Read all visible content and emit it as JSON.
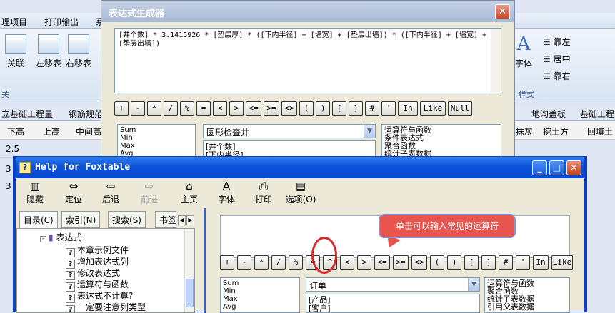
{
  "app": {
    "menu": [
      "理项目",
      "打印输出",
      "系"
    ],
    "ribbon_buttons": [
      "关联",
      "左移表",
      "右移表"
    ],
    "ribbon_right": [
      "字体",
      "靠左",
      "居中",
      "靠右"
    ],
    "ribbon_groups": [
      "关",
      "样式"
    ],
    "tabs_left": [
      "立基础工程量",
      "钢筋规范"
    ],
    "tabs_right": [
      "地沟盖板",
      "基础工程"
    ],
    "grid_headers": [
      "下高",
      "上高",
      "中间高"
    ],
    "grid_headers_right": [
      "抹灰",
      "挖土方",
      "回填土"
    ],
    "grid_values": [
      "2.5",
      "3",
      "3"
    ]
  },
  "expr_dialog": {
    "title": "表达式生成器",
    "close_glyph": "✕",
    "expression": "[井个数] * 3.1415926 * [垫层厚] * ([下内半径] + [墙宽] + [垫层出墙]) * ([下内半径] + [墙宽] + [垫层出墙])",
    "operators": [
      "+",
      "-",
      "*",
      "/",
      "%",
      "=",
      "<",
      ">",
      "<=",
      ">=",
      "<>",
      "(",
      ")",
      "[",
      "]",
      "#",
      "'",
      "In",
      "Like",
      "Null"
    ],
    "functions": [
      "Sum",
      "Min",
      "Max",
      "Avg"
    ],
    "table_combo": "圆形检查井",
    "fields": [
      "[井个数]",
      "[下内半径]"
    ],
    "categories": [
      "运算符与函数",
      "条件表达式",
      "聚合函数",
      "统计子表数据"
    ]
  },
  "help_window": {
    "title": "Help for Foxtable",
    "icon_glyph": "?",
    "minimize_glyph": "_",
    "maximize_glyph": "□",
    "close_glyph": "✕",
    "toolbar": [
      {
        "label": "隐藏",
        "icon": "hide-icon",
        "glyph": "▥",
        "enabled": true
      },
      {
        "label": "定位",
        "icon": "locate-icon",
        "glyph": "⇔",
        "enabled": true
      },
      {
        "label": "后退",
        "icon": "back-icon",
        "glyph": "⇦",
        "enabled": true
      },
      {
        "label": "前进",
        "icon": "forward-icon",
        "glyph": "⇨",
        "enabled": false
      },
      {
        "label": "主页",
        "icon": "home-icon",
        "glyph": "⌂",
        "enabled": true
      },
      {
        "label": "字体",
        "icon": "font-icon",
        "glyph": "A",
        "enabled": true
      },
      {
        "label": "打印",
        "icon": "print-icon",
        "glyph": "⎙",
        "enabled": true
      },
      {
        "label": "选项(O)",
        "icon": "options-icon",
        "glyph": "▤",
        "enabled": true
      }
    ],
    "nav_tabs": [
      "目录(C)",
      "索引(N)",
      "搜索(S)",
      "书签"
    ],
    "tree_parent": "表达式",
    "tree_items": [
      "本章示例文件",
      "增加表达式列",
      "修改表达式",
      "运算符与函数",
      "表达式不计算?",
      "一定要注意列类型"
    ],
    "tip_text": "单击可以输入常见的运算符",
    "inner_operators": [
      "+",
      "-",
      "*",
      "/",
      "%",
      "=",
      "^",
      "<",
      ">",
      "<=",
      ">=",
      "<>",
      "(",
      ")",
      "[",
      "]",
      "#",
      "'",
      "In",
      "Like"
    ],
    "inner_functions": [
      "Sum",
      "Min",
      "Max",
      "Avg"
    ],
    "inner_combo": "订单",
    "inner_fields": [
      "[产品]",
      "[客户]"
    ],
    "inner_categories": [
      "运算符与函数",
      "聚合函数",
      "统计子表数据",
      "引用父表数据"
    ]
  },
  "colors": {
    "help_title": "#0c53d8",
    "tip_bg": "#e8554e",
    "highlight": "#d62a2a"
  }
}
